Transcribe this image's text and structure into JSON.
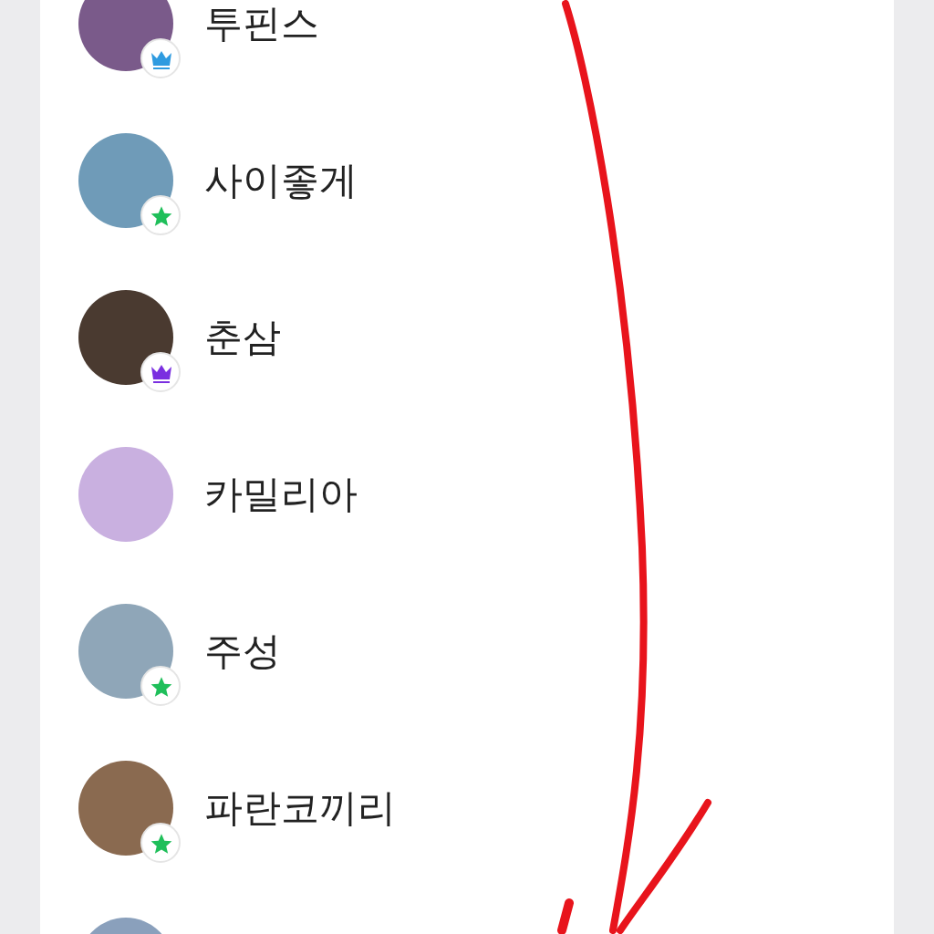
{
  "friends": [
    {
      "kind": "friend",
      "name": "투핀스",
      "badge": {
        "kind": "crown",
        "color": "#2f9be0"
      }
    },
    {
      "kind": "friend",
      "name": "사이좋게",
      "badge": {
        "kind": "star",
        "color": "#1fbf5a"
      }
    },
    {
      "kind": "friend",
      "name": "춘삼",
      "badge": {
        "kind": "crown",
        "color": "#7a2fe0"
      }
    },
    {
      "kind": "friend",
      "name": "카밀리아"
    },
    {
      "kind": "friend",
      "name": "주성",
      "badge": {
        "kind": "star",
        "color": "#1fbf5a"
      }
    },
    {
      "kind": "friend",
      "name": "파란코끼리",
      "badge": {
        "kind": "star",
        "color": "#1fbf5a"
      }
    },
    {
      "kind": "avatar"
    }
  ]
}
